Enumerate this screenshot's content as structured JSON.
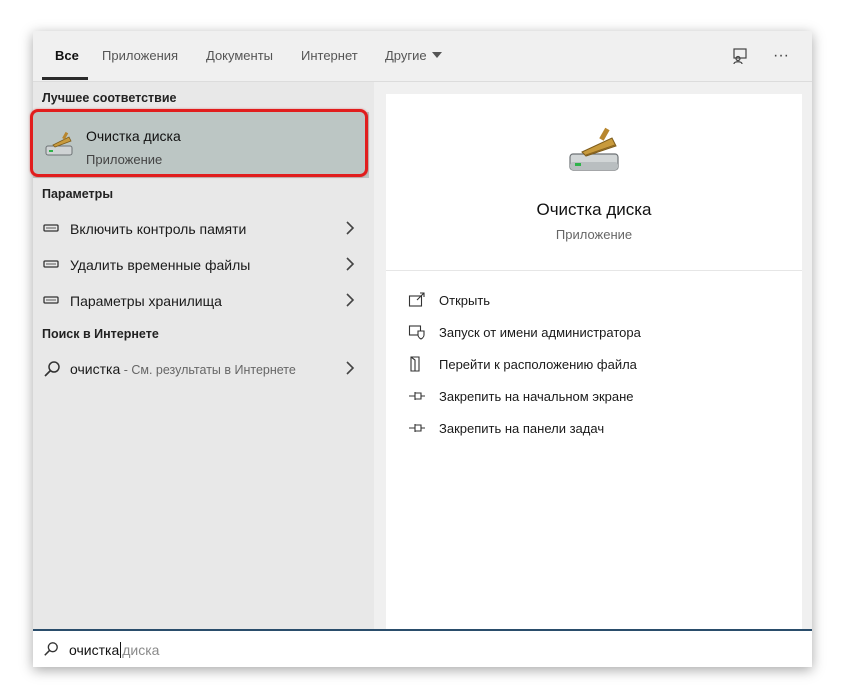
{
  "tabs": {
    "items": [
      {
        "label": "Все"
      },
      {
        "label": "Приложения"
      },
      {
        "label": "Документы"
      },
      {
        "label": "Интернет"
      },
      {
        "label": "Другие"
      }
    ],
    "active": "Все",
    "tools": {
      "feedback_icon": "feedback-icon",
      "more_icon": "more-icon",
      "more_glyph": "···"
    }
  },
  "best_match": {
    "section_label": "Лучшее соответствие",
    "title_match": "Очистка",
    "title_rest": " диска",
    "subtitle": "Приложение",
    "icon": "disk-cleanup-icon"
  },
  "settings": {
    "section_label": "Параметры",
    "items": [
      {
        "label": "Включить контроль памяти",
        "icon": "storage-icon"
      },
      {
        "label": "Удалить временные файлы",
        "icon": "storage-icon"
      },
      {
        "label": "Параметры хранилища",
        "icon": "storage-icon"
      }
    ]
  },
  "web": {
    "section_label": "Поиск в Интернете",
    "query": "очистка",
    "hint": " - См. результаты в Интернете"
  },
  "detail": {
    "title": "Очистка диска",
    "subtitle": "Приложение",
    "actions": [
      {
        "label": "Открыть",
        "icon": "open-icon"
      },
      {
        "label": "Запуск от имени администратора",
        "icon": "admin-shield-icon"
      },
      {
        "label": "Перейти к расположению файла",
        "icon": "file-location-icon"
      },
      {
        "label": "Закрепить на начальном экране",
        "icon": "pin-icon"
      },
      {
        "label": "Закрепить на панели задач",
        "icon": "pin-icon"
      }
    ]
  },
  "search": {
    "typed": "очистка",
    "suggestion": "диска"
  },
  "colors": {
    "highlight_bg": "#bcc6c4",
    "outline": "#e11d1d",
    "search_border": "#2a4d6b"
  }
}
